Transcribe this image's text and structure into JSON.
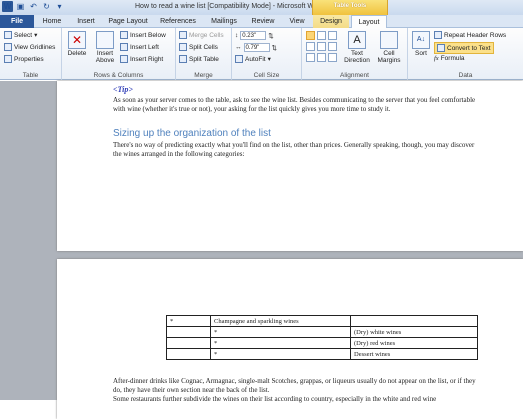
{
  "window": {
    "title": "How to read a wine list [Compatibility Mode] - Microsoft Word",
    "contextual_band": "Table Tools"
  },
  "tabs": [
    "File",
    "Home",
    "Insert",
    "Page Layout",
    "References",
    "Mailings",
    "Review",
    "View",
    "Design",
    "Layout"
  ],
  "ribbon": {
    "table": {
      "label": "Table",
      "select": "Select",
      "view_gridlines": "View Gridlines",
      "properties": "Properties"
    },
    "rows_columns": {
      "label": "Rows & Columns",
      "delete": "Delete",
      "insert_above": "Insert Above",
      "insert_below": "Insert Below",
      "insert_left": "Insert Left",
      "insert_right": "Insert Right"
    },
    "merge": {
      "label": "Merge",
      "merge_cells": "Merge Cells",
      "split_cells": "Split Cells",
      "split_table": "Split Table"
    },
    "cell_size": {
      "label": "Cell Size",
      "height": "0.23\"",
      "width": "0.79\"",
      "autofit": "AutoFit"
    },
    "alignment": {
      "label": "Alignment",
      "text_direction": "Text Direction",
      "cell_margins": "Cell Margins"
    },
    "data": {
      "label": "Data",
      "sort": "Sort",
      "repeat_header_rows": "Repeat Header Rows",
      "convert_to_text": "Convert to Text",
      "formula": "Formula"
    }
  },
  "document": {
    "tip": "<Tip>",
    "tip_text": "As soon as your server comes to the table, ask to see the wine list. Besides communicating to the server that you feel comfortable with wine (whether it's true or not), your asking for the list quickly gives you more time to study it.",
    "heading": "Sizing up the organization of the list",
    "intro": "There's no way of predicting exactly what you'll find on the list, other than prices. Generally speaking, though, you may discover the wines arranged in the following categories:",
    "table": [
      [
        "*",
        "Champagne and sparkling wines",
        ""
      ],
      [
        "",
        "*",
        "(Dry) white wines"
      ],
      [
        "",
        "*",
        "(Dry) red wines"
      ],
      [
        "",
        "*",
        "Dessert wines"
      ]
    ],
    "after_table_1": "After-dinner drinks like Cognac, Armagnac, single-malt Scotches, grappas, or liqueurs usually do not appear on the list, or if they do, they have their own section near the back of the list.",
    "after_table_2": "Some restaurants further subdivide the wines on their list according to country, especially in the white and red wine"
  }
}
